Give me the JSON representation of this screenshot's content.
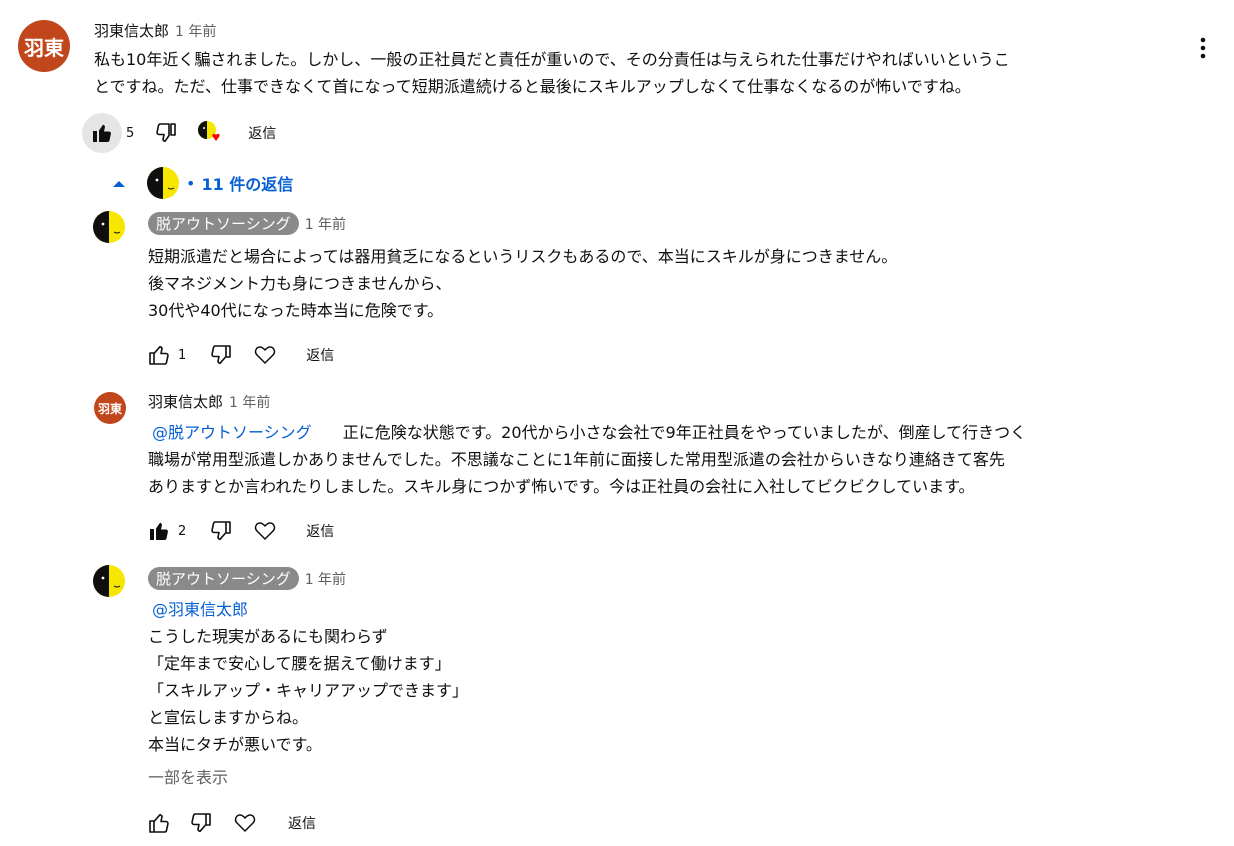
{
  "main_comment": {
    "avatar_text": "羽東",
    "author": "羽東信太郎",
    "time": "1 年前",
    "text_line1": "私も10年近く騙されました。しかし、一般の正社員だと責任が重いので、その分責任は与えられた仕事だけやればいいというこ",
    "text_line2": "とですね。ただ、仕事できなくて首になって短期派遣続けると最後にスキルアップしなくて仕事なくなるのが怖いですね。",
    "like_count": "5",
    "reply_label": "返信"
  },
  "replies_toggle": {
    "label": "11 件の返信"
  },
  "replies": [
    {
      "author": "脱アウトソーシング",
      "time": "1 年前",
      "lines": [
        "短期派遣だと場合によっては器用貧乏になるというリスクもあるので、本当にスキルが身につきません。",
        "後マネジメント力も身につきませんから、",
        "30代や40代になった時本当に危険です。"
      ],
      "like_count": "1",
      "reply_label": "返信"
    },
    {
      "avatar_text": "羽東",
      "author": "羽東信太郎",
      "time": "1 年前",
      "mention": "@脱アウトソーシング",
      "line1_rest": "正に危険な状態です。20代から小さな会社で9年正社員をやっていましたが、倒産して行きつく",
      "line2": "職場が常用型派遣しかありませんでした。不思議なことに1年前に面接した常用型派遣の会社からいきなり連絡きて客先",
      "line3": "ありますとか言われたりしました。スキル身につかず怖いです。今は正社員の会社に入社してビクビクしています。",
      "like_count": "2",
      "reply_label": "返信"
    },
    {
      "author": "脱アウトソーシング",
      "time": "1 年前",
      "mention": "@羽東信太郎",
      "lines": [
        "こうした現実があるにも関わらず",
        "「定年まで安心して腰を据えて働けます」",
        "「スキルアップ・キャリアアップできます」",
        "と宣伝しますからね。",
        "本当にタチが悪いです。"
      ],
      "show_more": "一部を表示",
      "reply_label": "返信"
    }
  ]
}
